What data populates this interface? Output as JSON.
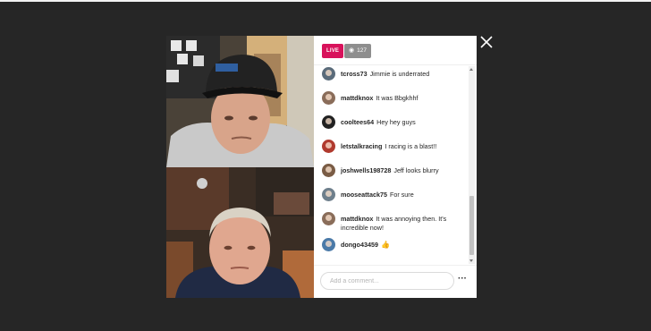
{
  "header": {
    "live_label": "LIVE",
    "viewer_icon": "eye-icon",
    "viewer_count": "127"
  },
  "close_icon": "close-icon",
  "comments": [
    {
      "username": "tcross73",
      "text": "Jimmie is underrated",
      "avatar_color": "#5a6b7a"
    },
    {
      "username": "mattdknox",
      "text": "It was Bbgkhhf",
      "avatar_color": "#8a6d5a"
    },
    {
      "username": "cooltees64",
      "text": "Hey hey guys",
      "avatar_color": "#222222"
    },
    {
      "username": "letstalkracing",
      "text": "I racing is a blast!!",
      "avatar_color": "#b03a2e"
    },
    {
      "username": "joshwells198728",
      "text": "Jeff looks blurry",
      "avatar_color": "#7a5c45"
    },
    {
      "username": "mooseattack75",
      "text": "For sure",
      "avatar_color": "#6e7f8c"
    },
    {
      "username": "mattdknox",
      "text": "It was annoying then. It's incredible now!",
      "avatar_color": "#8a6d5a"
    },
    {
      "username": "dongo43459",
      "text": "",
      "emoji": "👍",
      "avatar_color": "#4b7aa8"
    }
  ],
  "footer": {
    "comment_placeholder": "Add a comment...",
    "more_label": "···",
    "more_icon": "more-options-icon"
  },
  "colors": {
    "live": "#d8125b",
    "viewers": "#8e8e8e",
    "backdrop": "#262626"
  }
}
